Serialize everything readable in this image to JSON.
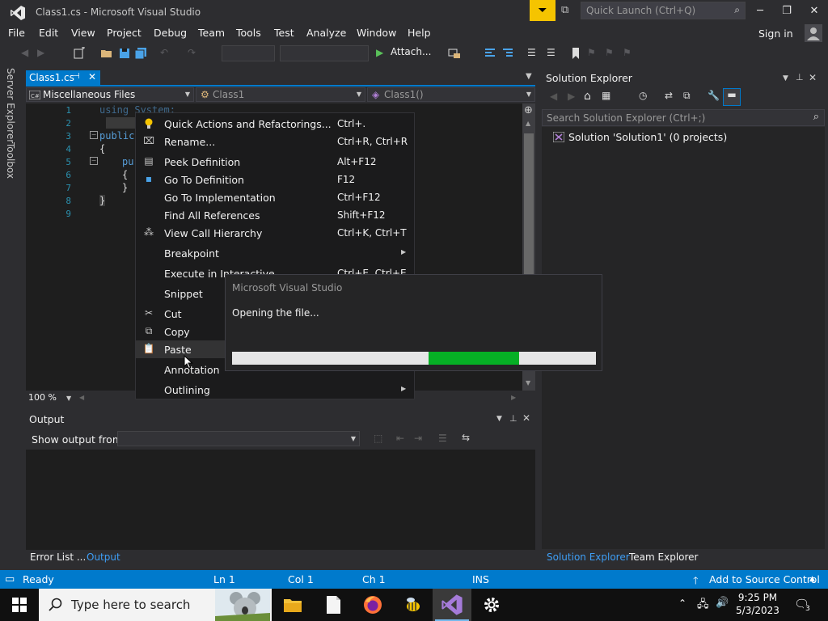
{
  "window": {
    "title": "Class1.cs - Microsoft Visual Studio",
    "quick_launch_placeholder": "Quick Launch (Ctrl+Q)",
    "sign_in": "Sign in"
  },
  "menu": [
    "File",
    "Edit",
    "View",
    "Project",
    "Debug",
    "Team",
    "Tools",
    "Test",
    "Analyze",
    "Window",
    "Help"
  ],
  "toolbar": {
    "attach_label": "Attach..."
  },
  "left_rail": {
    "server_explorer": "Server Explorer",
    "toolbox": "Toolbox"
  },
  "doc_tab": {
    "label": "Class1.cs",
    "pin": "⊣",
    "close": "✕"
  },
  "nav_bar": {
    "project": "Miscellaneous Files",
    "type": "Class1",
    "member": "Class1()"
  },
  "code": {
    "line_numbers": [
      "1",
      "2",
      "3",
      "4",
      "5",
      "6",
      "7",
      "8",
      "9"
    ],
    "using_line": "using System;",
    "public_kw": "public",
    "brace_open": "{",
    "pu_frag": "pu",
    "inner_open": "{",
    "inner_close": "}",
    "brace_close": "}"
  },
  "editor": {
    "zoom": "100 %"
  },
  "context_menu": [
    {
      "label": "Quick Actions and Refactorings...",
      "shortcut": "Ctrl+.",
      "icon": "lightbulb-icon"
    },
    {
      "label": "Rename...",
      "shortcut": "Ctrl+R, Ctrl+R",
      "icon": "rename-icon"
    },
    {
      "label": "Peek Definition",
      "shortcut": "Alt+F12",
      "icon": "peek-icon"
    },
    {
      "label": "Go To Definition",
      "shortcut": "F12",
      "icon": "goto-definition-icon"
    },
    {
      "label": "Go To Implementation",
      "shortcut": "Ctrl+F12",
      "icon": ""
    },
    {
      "label": "Find All References",
      "shortcut": "Shift+F12",
      "icon": ""
    },
    {
      "label": "View Call Hierarchy",
      "shortcut": "Ctrl+K, Ctrl+T",
      "icon": "call-hierarchy-icon"
    },
    {
      "label": "Breakpoint",
      "shortcut": "",
      "icon": "",
      "submenu": true
    },
    {
      "label": "Execute in Interactive",
      "shortcut": "Ctrl+E, Ctrl+E",
      "icon": ""
    },
    {
      "label": "Snippet",
      "shortcut": "",
      "icon": "",
      "submenu": true
    },
    {
      "label": "Cut",
      "shortcut": "",
      "icon": "scissors-icon"
    },
    {
      "label": "Copy",
      "shortcut": "",
      "icon": "copy-icon"
    },
    {
      "label": "Paste",
      "shortcut": "",
      "icon": "paste-icon"
    },
    {
      "label": "Annotation",
      "shortcut": "",
      "icon": "",
      "submenu": true
    },
    {
      "label": "Outlining",
      "shortcut": "",
      "icon": "",
      "submenu": true
    }
  ],
  "dialog": {
    "title": "Microsoft Visual Studio",
    "message": "Opening the file...",
    "progress_start": 0.54,
    "progress_end": 0.788
  },
  "output": {
    "title": "Output",
    "show_from_label": "Show output from:",
    "tabs": [
      "Error List ...",
      "Output"
    ]
  },
  "solution_explorer": {
    "title": "Solution Explorer",
    "search_placeholder": "Search Solution Explorer (Ctrl+;)",
    "solution_item": "Solution 'Solution1' (0 projects)",
    "tabs": [
      "Solution Explorer",
      "Team Explorer"
    ]
  },
  "status": {
    "ready": "Ready",
    "ln": "Ln 1",
    "col": "Col 1",
    "ch": "Ch 1",
    "ins": "INS",
    "source_control": "Add to Source Control"
  },
  "taskbar": {
    "search_placeholder": "Type here to search",
    "time": "9:25 PM",
    "date": "5/3/2023",
    "notification_count": "3"
  },
  "colors": {
    "accent": "#007acc",
    "progress": "#06b025",
    "notification": "#f5c400"
  }
}
